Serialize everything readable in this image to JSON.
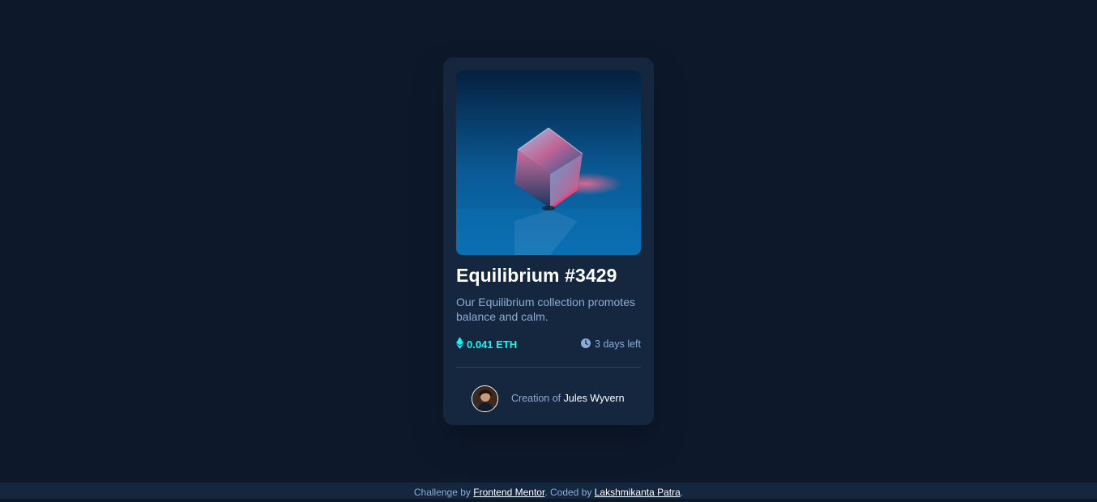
{
  "card": {
    "title": "Equilibrium #3429",
    "description": "Our Equilibrium collection promotes balance and calm.",
    "price": "0.041 ETH",
    "time_left": "3 days left",
    "creator_prefix": "Creation of",
    "creator_name": "Jules Wyvern"
  },
  "footer": {
    "prefix": "Challenge by",
    "challenge_link": "Frontend Mentor",
    "middle": ". Coded by",
    "author_link": "Lakshmikanta Patra",
    "suffix": "."
  },
  "icons": {
    "price": "ethereum-icon",
    "time": "clock-icon"
  },
  "colors": {
    "page_bg": "#0d192b",
    "card_bg": "#15263f",
    "accent_cyan": "#00fff8",
    "soft_blue": "#8bacd9",
    "white": "#ffffff"
  }
}
